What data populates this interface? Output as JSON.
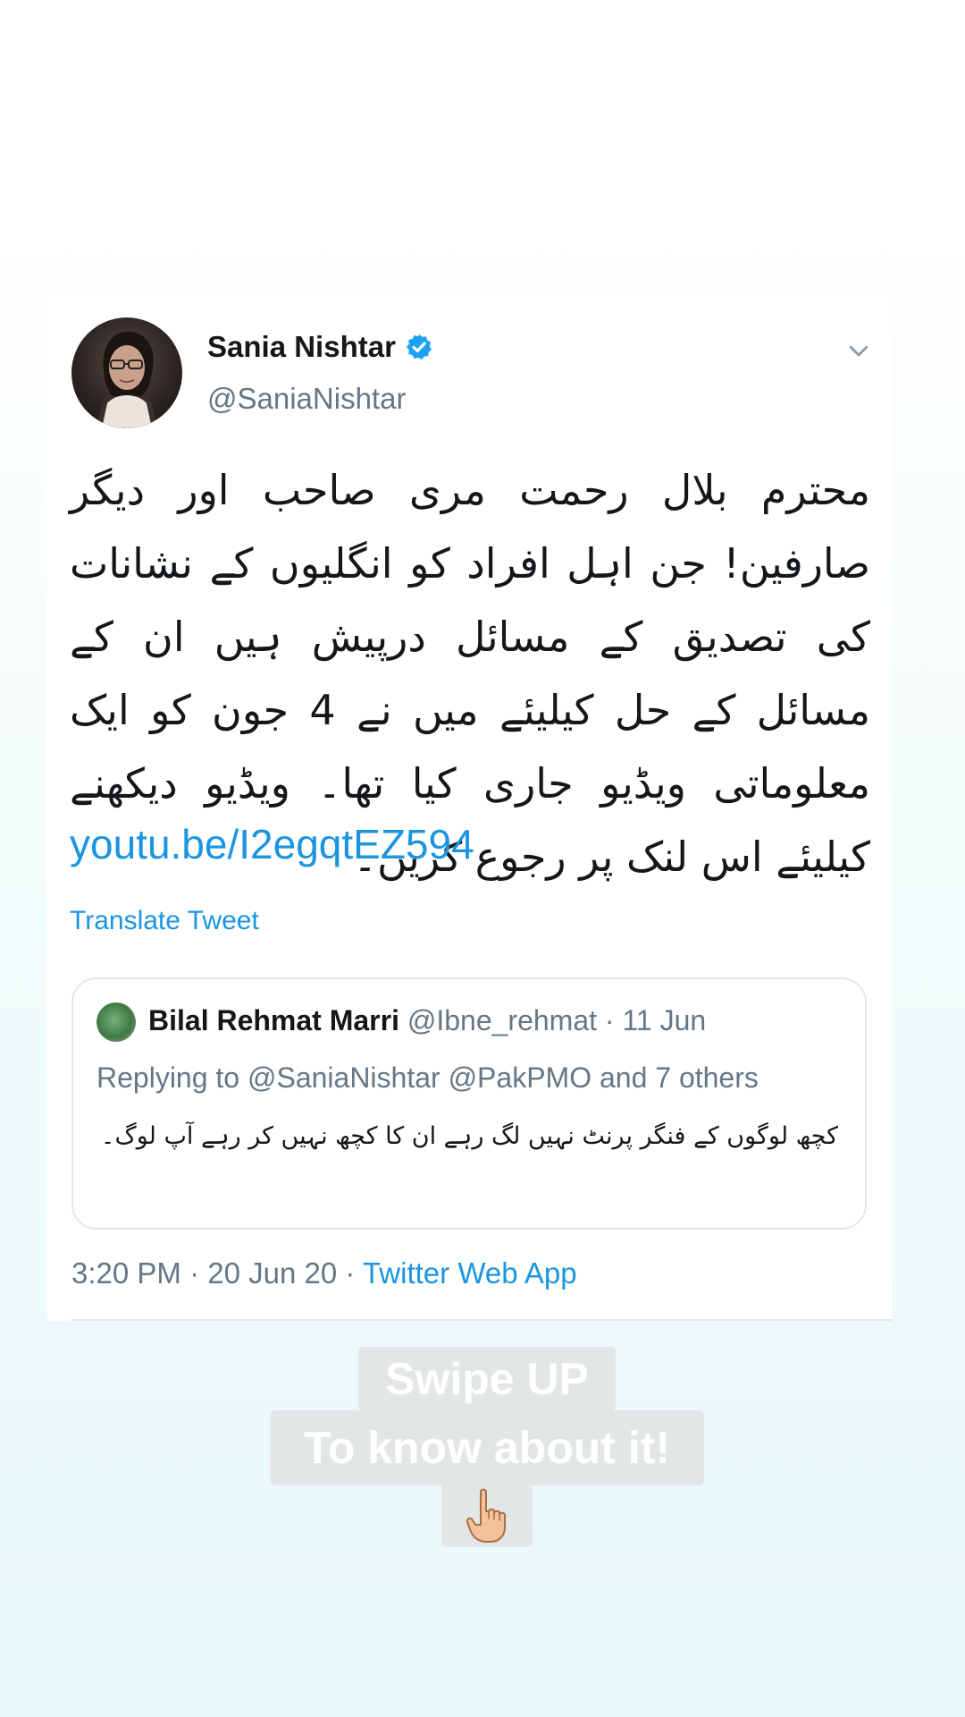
{
  "tweet": {
    "display_name": "Sania Nishtar",
    "handle": "@SaniaNishtar",
    "body": "محترم بلال رحمت مری صاحب اور دیگر صارفین! جن اہل افراد کو انگلیوں کے نشانات کی تصدیق کے مسائل درپیش ہیں ان کے مسائل کے حل کیلیئے میں نے 4 جون کو ایک معلوماتی ویڈیو جاری کیا تھا۔ ویڈیو دیکھنے کیلیئے اس لنک پر رجوع کریں۔",
    "link": "youtu.be/I2egqtEZ594",
    "translate_label": "Translate Tweet",
    "time": "3:20 PM",
    "date": "20 Jun 20",
    "source": "Twitter Web App",
    "separator": "·"
  },
  "quoted": {
    "display_name": "Bilal Rehmat Marri",
    "handle": "@Ibne_rehmat",
    "date": "11 Jun",
    "separator": "·",
    "replying_to": "Replying to @SaniaNishtar @PakPMO and 7 others",
    "body": "کچھ لوگوں کے فنگر پرنٹ نہیں لگ رہے ان کا کچھ نہیں کر رہے آپ لوگ۔"
  },
  "sticker": {
    "line1": "Swipe UP",
    "line2": "To know about it!",
    "emoji_icon": "pointing-up-hand-icon"
  },
  "colors": {
    "link_blue": "#1b95e0",
    "muted_gray": "#657786",
    "text_dark": "#14171a",
    "verified_blue": "#1da1f2",
    "sticker_bg": "#e3e6e6"
  }
}
